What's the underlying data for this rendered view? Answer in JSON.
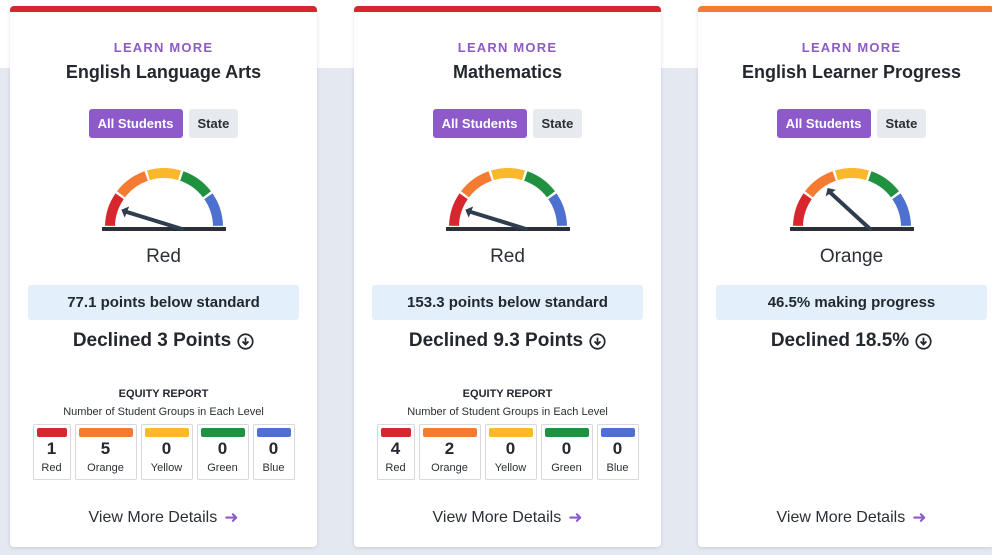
{
  "colors": {
    "accent_purple": "#8e59c9",
    "red": "#d7262e",
    "orange": "#f47b31",
    "yellow": "#f9b92a",
    "green": "#1f9141",
    "blue": "#4e71d1",
    "status_bg": "#e3f0fc"
  },
  "cards": [
    {
      "topbar_color": "#d7262e",
      "learn_more": "LEARN MORE",
      "title": "English Language Arts",
      "toggle_all": "All Students",
      "toggle_state": "State",
      "gauge_level": "Red",
      "gauge_needle_angle_deg": 158,
      "status": "77.1 points below standard",
      "change": "Declined 3 Points",
      "change_icon": "circle-down-arrow-icon",
      "equity_title": "EQUITY REPORT",
      "equity_subtitle": "Number of Student Groups in Each Level",
      "levels": [
        {
          "count": "1",
          "name": "Red",
          "color": "#d7262e"
        },
        {
          "count": "5",
          "name": "Orange",
          "color": "#f47b31"
        },
        {
          "count": "0",
          "name": "Yellow",
          "color": "#f9b92a"
        },
        {
          "count": "0",
          "name": "Green",
          "color": "#1f9141"
        },
        {
          "count": "0",
          "name": "Blue",
          "color": "#4e71d1"
        }
      ],
      "view_more": "View More Details"
    },
    {
      "topbar_color": "#d7262e",
      "learn_more": "LEARN MORE",
      "title": "Mathematics",
      "toggle_all": "All Students",
      "toggle_state": "State",
      "gauge_level": "Red",
      "gauge_needle_angle_deg": 158,
      "status": "153.3 points below standard",
      "change": "Declined 9.3 Points",
      "change_icon": "circle-down-arrow-icon",
      "equity_title": "EQUITY REPORT",
      "equity_subtitle": "Number of Student Groups in Each Level",
      "levels": [
        {
          "count": "4",
          "name": "Red",
          "color": "#d7262e"
        },
        {
          "count": "2",
          "name": "Orange",
          "color": "#f47b31"
        },
        {
          "count": "0",
          "name": "Yellow",
          "color": "#f9b92a"
        },
        {
          "count": "0",
          "name": "Green",
          "color": "#1f9141"
        },
        {
          "count": "0",
          "name": "Blue",
          "color": "#4e71d1"
        }
      ],
      "view_more": "View More Details"
    },
    {
      "topbar_color": "#f47b31",
      "learn_more": "LEARN MORE",
      "title": "English Learner Progress",
      "toggle_all": "All Students",
      "toggle_state": "State",
      "gauge_level": "Orange",
      "gauge_needle_angle_deg": 122,
      "status": "46.5% making progress",
      "change": "Declined 18.5%",
      "change_icon": "circle-down-arrow-icon",
      "view_more": "View More Details"
    }
  ]
}
